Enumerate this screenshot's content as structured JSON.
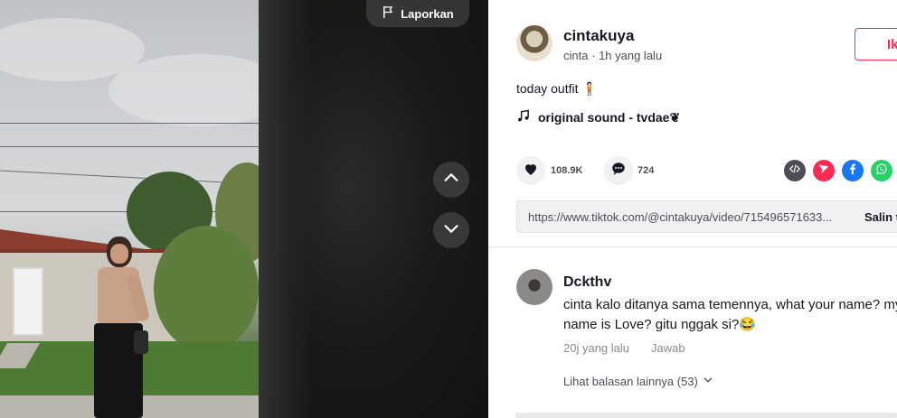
{
  "video": {
    "report_label": "Laporkan"
  },
  "post": {
    "username": "cintakuya",
    "nickname": "cinta",
    "separator": "·",
    "time": "1h yang lalu",
    "follow_label": "Ik",
    "caption": "today outfit 🧍🏻",
    "sound": "original sound - tvdae❦"
  },
  "stats": {
    "likes": "108.9K",
    "comments": "724"
  },
  "share": {
    "link": "https://www.tiktok.com/@cintakuya/video/715496571633...",
    "copy_label": "Salin t"
  },
  "comment": {
    "username": "Dckthv",
    "text": "cinta kalo ditanya sama temennya, what your name? my name is Love? gitu nggak si?😂",
    "time": "20j yang lalu",
    "reply_label": "Jawab",
    "more_replies": "Lihat balasan lainnya (53)"
  },
  "colors": {
    "accent": "#fe2c55",
    "embed": "#4d4e57",
    "send": "#fe2c55",
    "facebook": "#1877f2",
    "whatsapp": "#25d366"
  },
  "icons": [
    "flag-icon",
    "chevron-up-icon",
    "chevron-down-icon",
    "music-note-icon",
    "heart-icon",
    "comment-icon",
    "embed-icon",
    "send-icon",
    "facebook-icon",
    "whatsapp-icon"
  ]
}
